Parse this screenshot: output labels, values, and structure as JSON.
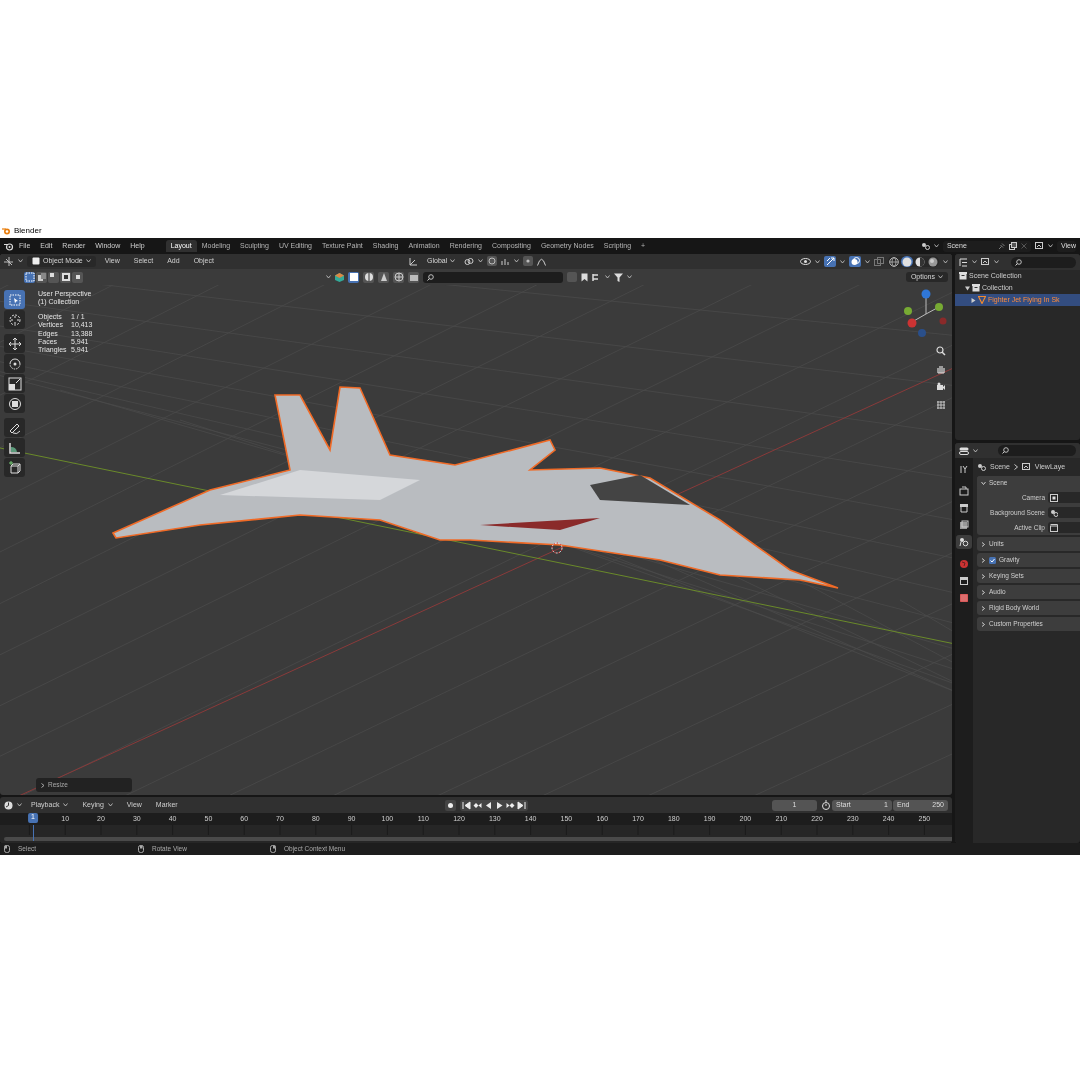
{
  "window": {
    "title": "Blender"
  },
  "topbar": {
    "menus": [
      "File",
      "Edit",
      "Render",
      "Window",
      "Help"
    ],
    "workspaces": [
      {
        "label": "Layout",
        "selected": true
      },
      {
        "label": "Modeling",
        "selected": false
      },
      {
        "label": "Sculpting",
        "selected": false
      },
      {
        "label": "UV Editing",
        "selected": false
      },
      {
        "label": "Texture Paint",
        "selected": false
      },
      {
        "label": "Shading",
        "selected": false
      },
      {
        "label": "Animation",
        "selected": false
      },
      {
        "label": "Rendering",
        "selected": false
      },
      {
        "label": "Compositing",
        "selected": false
      },
      {
        "label": "Geometry Nodes",
        "selected": false
      },
      {
        "label": "Scripting",
        "selected": false
      }
    ],
    "add_tab": "+",
    "scene": "Scene",
    "view_layer": "View"
  },
  "viewport": {
    "mode": "Object Mode",
    "menus": [
      "View",
      "Select",
      "Add",
      "Object"
    ],
    "orientation": "Global",
    "options": "Options",
    "select_modes": [
      {
        "selected": true
      },
      {
        "selected": false
      },
      {
        "selected": false
      },
      {
        "selected": false
      },
      {
        "selected": false
      }
    ],
    "shading": [
      {
        "kind": "wireframe",
        "selected": false
      },
      {
        "kind": "solid",
        "selected": true
      },
      {
        "kind": "material",
        "selected": false
      },
      {
        "kind": "rendered",
        "selected": false
      }
    ],
    "view_name": "User Perspective",
    "collection": "(1) Collection",
    "stats": [
      {
        "label": "Objects",
        "value": "1 / 1"
      },
      {
        "label": "Vertices",
        "value": "10,413"
      },
      {
        "label": "Edges",
        "value": "13,388"
      },
      {
        "label": "Faces",
        "value": "5,941"
      },
      {
        "label": "Triangles",
        "value": "5,941"
      }
    ],
    "tools": [
      {
        "kind": "select",
        "selected": true
      },
      {
        "kind": "cursor",
        "selected": false
      },
      {
        "kind": "move",
        "selected": false
      },
      {
        "kind": "rotate",
        "selected": false
      },
      {
        "kind": "scale",
        "selected": false
      },
      {
        "kind": "transform",
        "selected": false
      },
      {
        "kind": "annotate",
        "selected": false
      },
      {
        "kind": "measure",
        "selected": false
      },
      {
        "kind": "add_cube",
        "selected": false
      }
    ],
    "last_operator": "Resize"
  },
  "outliner": {
    "tree": [
      {
        "label": "Scene Collection",
        "children": [
          {
            "label": "Collection",
            "expanded": true,
            "selected": false,
            "children": [
              {
                "label": "Fighter Jet Flying In Sk",
                "expanded": false,
                "selected": true
              }
            ]
          }
        ]
      }
    ]
  },
  "properties": {
    "tabs": [
      {
        "kind": "tool",
        "selected": false
      },
      {
        "kind": "render",
        "selected": false
      },
      {
        "kind": "output",
        "selected": false
      },
      {
        "kind": "view_layer",
        "selected": false
      },
      {
        "kind": "scene",
        "selected": true
      },
      {
        "kind": "world",
        "selected": false
      },
      {
        "kind": "collection",
        "selected": false
      },
      {
        "kind": "texture",
        "selected": false
      }
    ],
    "breadcrumb": [
      "Scene",
      "ViewLaye"
    ],
    "panel": {
      "title": "Scene",
      "expanded": true,
      "fields": [
        {
          "label": "Camera",
          "kind": "camera"
        },
        {
          "label": "Background Scene",
          "kind": "scene"
        },
        {
          "label": "Active Clip",
          "kind": "clip"
        }
      ]
    },
    "subpanels": [
      {
        "title": "Units",
        "expanded": false
      },
      {
        "title": "Gravity",
        "expanded": false,
        "checked": true
      },
      {
        "title": "Keying Sets",
        "expanded": false
      },
      {
        "title": "Audio",
        "expanded": false
      },
      {
        "title": "Rigid Body World",
        "expanded": false
      },
      {
        "title": "Custom Properties",
        "expanded": false
      }
    ]
  },
  "timeline": {
    "menus": [
      "Playback",
      "Keying",
      "View",
      "Marker"
    ],
    "current_frame": "1",
    "start_label": "Start",
    "start": "1",
    "end_label": "End",
    "end": "250",
    "ruler": [
      {
        "label": "1",
        "current": true
      },
      {
        "label": "10",
        "current": false
      },
      {
        "label": "20",
        "current": false
      },
      {
        "label": "30",
        "current": false
      },
      {
        "label": "40",
        "current": false
      },
      {
        "label": "50",
        "current": false
      },
      {
        "label": "60",
        "current": false
      },
      {
        "label": "70",
        "current": false
      },
      {
        "label": "80",
        "current": false
      },
      {
        "label": "90",
        "current": false
      },
      {
        "label": "100",
        "current": false
      },
      {
        "label": "110",
        "current": false
      },
      {
        "label": "120",
        "current": false
      },
      {
        "label": "130",
        "current": false
      },
      {
        "label": "140",
        "current": false
      },
      {
        "label": "150",
        "current": false
      },
      {
        "label": "160",
        "current": false
      },
      {
        "label": "170",
        "current": false
      },
      {
        "label": "180",
        "current": false
      },
      {
        "label": "190",
        "current": false
      },
      {
        "label": "200",
        "current": false
      },
      {
        "label": "210",
        "current": false
      },
      {
        "label": "220",
        "current": false
      },
      {
        "label": "230",
        "current": false
      },
      {
        "label": "240",
        "current": false
      },
      {
        "label": "250",
        "current": false
      }
    ]
  },
  "status_bar": [
    "Select",
    "Rotate View",
    "Object Context Menu"
  ]
}
